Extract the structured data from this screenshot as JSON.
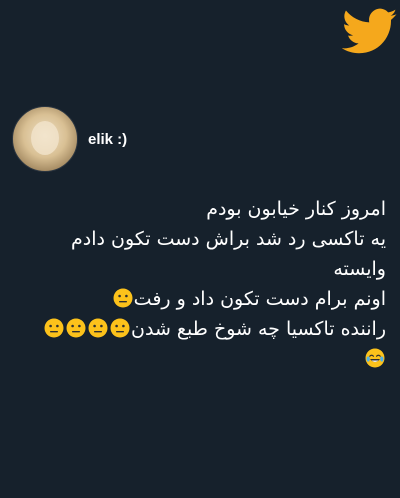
{
  "brand": {
    "logo_icon": "twitter-bird-icon",
    "logo_color": "#f5a81c"
  },
  "author": {
    "username": "elik :)",
    "avatar_icon": "profile-avatar"
  },
  "tweet": {
    "lines": [
      "امروز کنار خیابون بودم",
      "یه تاکسی رد شد براش دست تکون دادم",
      "وایسته",
      "اونم برام دست تکون داد و رفت",
      "راننده تاکسیا چه شوخ طبع شدن"
    ],
    "emojis": {
      "neutral_face": "neutral-face-emoji",
      "tears_of_joy": "face-with-tears-of-joy-emoji"
    }
  },
  "colors": {
    "background": "#16212c",
    "text": "#ffffff",
    "emoji_yellow": "#fcc21b"
  }
}
